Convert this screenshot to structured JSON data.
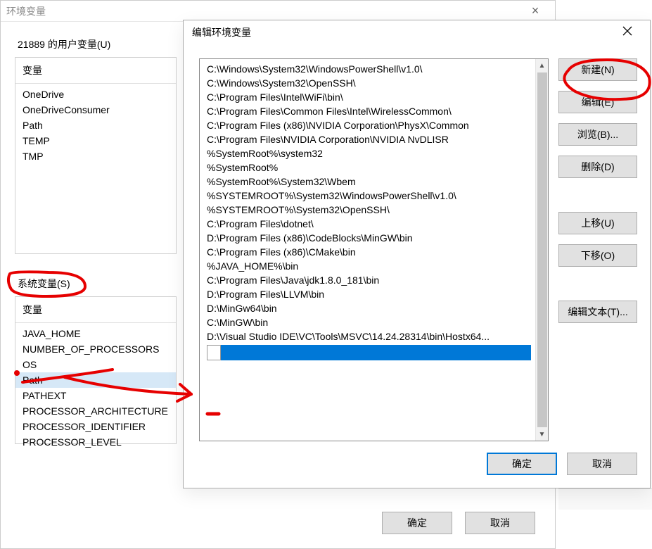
{
  "back_dialog": {
    "title": "环境变量",
    "close": "×",
    "user_section_label": "21889 的用户变量(U)",
    "user_header": "变量",
    "user_vars": [
      "OneDrive",
      "OneDriveConsumer",
      "Path",
      "TEMP",
      "TMP"
    ],
    "sys_section_label": "系统变量(S)",
    "sys_header": "变量",
    "sys_vars": [
      "JAVA_HOME",
      "NUMBER_OF_PROCESSORS",
      "OS",
      "Path",
      "PATHEXT",
      "PROCESSOR_ARCHITECTURE",
      "PROCESSOR_IDENTIFIER",
      "PROCESSOR_LEVEL"
    ],
    "sys_selected_index": 3,
    "ok": "确定",
    "cancel": "取消"
  },
  "front_dialog": {
    "title": "编辑环境变量",
    "close": "×",
    "paths": [
      "C:\\Windows\\System32\\WindowsPowerShell\\v1.0\\",
      "C:\\Windows\\System32\\OpenSSH\\",
      "C:\\Program Files\\Intel\\WiFi\\bin\\",
      "C:\\Program Files\\Common Files\\Intel\\WirelessCommon\\",
      "C:\\Program Files (x86)\\NVIDIA Corporation\\PhysX\\Common",
      "C:\\Program Files\\NVIDIA Corporation\\NVIDIA NvDLISR",
      "%SystemRoot%\\system32",
      "%SystemRoot%",
      "%SystemRoot%\\System32\\Wbem",
      "%SYSTEMROOT%\\System32\\WindowsPowerShell\\v1.0\\",
      "%SYSTEMROOT%\\System32\\OpenSSH\\",
      "C:\\Program Files\\dotnet\\",
      "D:\\Program Files (x86)\\CodeBlocks\\MinGW\\bin",
      "C:\\Program Files (x86)\\CMake\\bin",
      "%JAVA_HOME%\\bin",
      "C:\\Program Files\\Java\\jdk1.8.0_181\\bin",
      "D:\\Program Files\\LLVM\\bin",
      "D:\\MinGw64\\bin",
      "C:\\MinGW\\bin",
      "D:\\Visual Studio IDE\\VC\\Tools\\MSVC\\14.24.28314\\bin\\Hostx64..."
    ],
    "buttons": {
      "new": "新建(N)",
      "edit": "编辑(E)",
      "browse": "浏览(B)...",
      "delete": "删除(D)",
      "move_up": "上移(U)",
      "move_down": "下移(O)",
      "edit_text": "编辑文本(T)..."
    },
    "ok": "确定",
    "cancel": "取消"
  },
  "annotation_color": "#e60000"
}
